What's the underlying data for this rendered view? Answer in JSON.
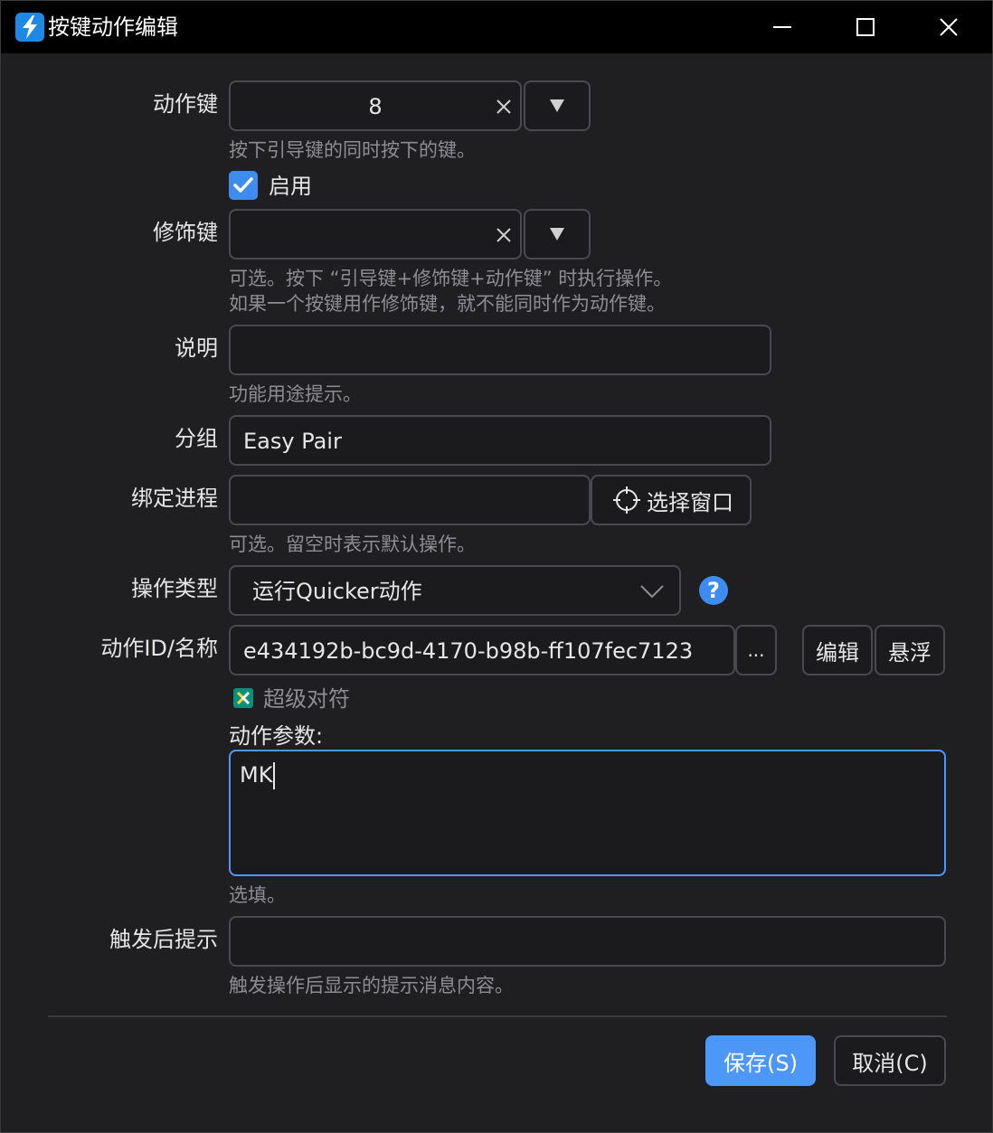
{
  "window": {
    "title": "按键动作编辑",
    "app_icon": "quicker-lightning-icon",
    "controls": {
      "minimize": "minimize-icon",
      "maximize": "maximize-icon",
      "close": "close-icon"
    }
  },
  "form": {
    "action_key": {
      "label": "动作键",
      "value": "8",
      "hint": "按下引导键的同时按下的键。"
    },
    "enabled": {
      "label": "启用",
      "checked": true
    },
    "modifier_key": {
      "label": "修饰键",
      "value": "",
      "hint_line1": "可选。按下 “引导键+修饰键+动作键” 时执行操作。",
      "hint_line2": "如果一个按键用作修饰键，就不能同时作为动作键。"
    },
    "description": {
      "label": "说明",
      "value": "",
      "hint": "功能用途提示。"
    },
    "group": {
      "label": "分组",
      "value": "Easy Pair"
    },
    "bind_process": {
      "label": "绑定进程",
      "value": "",
      "select_window_label": "选择窗口",
      "hint": "可选。留空时表示默认操作。"
    },
    "operation_type": {
      "label": "操作类型",
      "value": "运行Quicker动作"
    },
    "action_id": {
      "label": "动作ID/名称",
      "value": "e434192b-bc9d-4170-b98b-ff107fec7123",
      "browse_label": "...",
      "edit_label": "编辑",
      "float_label": "悬浮",
      "action_name": "超级对符"
    },
    "action_params": {
      "label": "动作参数:",
      "value": "MK",
      "hint": "选填。"
    },
    "after_trigger_tip": {
      "label": "触发后提示",
      "value": "",
      "hint": "触发操作后显示的提示消息内容。"
    }
  },
  "footer": {
    "save_label": "保存(S)",
    "cancel_label": "取消(C)"
  },
  "colors": {
    "accent": "#4c97f8",
    "background": "#1f1f21",
    "titlebar": "#000000"
  }
}
